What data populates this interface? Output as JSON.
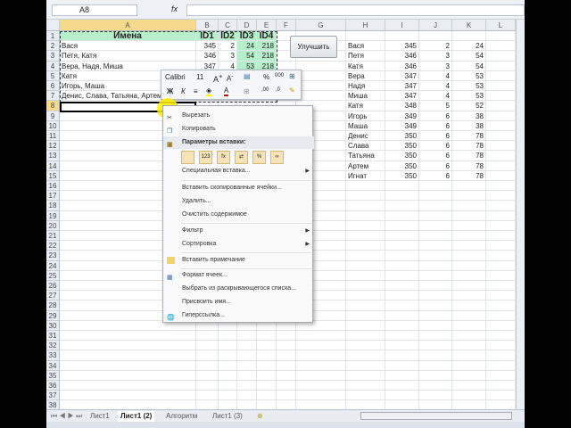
{
  "formula_bar": {
    "name_box": "A8",
    "fx": "fx",
    "formula": ""
  },
  "columns": [
    "A",
    "B",
    "C",
    "D",
    "E",
    "F",
    "G",
    "H",
    "I",
    "J",
    "K",
    "L"
  ],
  "header_row": [
    "Имена",
    "ID1",
    "ID2",
    "ID3",
    "ID4"
  ],
  "table": [
    [
      "Вася",
      "345",
      "2",
      "24",
      "218"
    ],
    [
      "Петя, Катя",
      "346",
      "3",
      "54",
      "218"
    ],
    [
      "Вера, Надя, Миша",
      "347",
      "4",
      "53",
      "218"
    ],
    [
      "Катя",
      "",
      "",
      "",
      ""
    ],
    [
      "Игорь, Маша",
      "",
      "",
      "",
      ""
    ],
    [
      "Денис, Слава, Татьяна, Артем, Игнат",
      "",
      "",
      "",
      ""
    ]
  ],
  "right_table": [
    [
      "Вася",
      "345",
      "2",
      "24"
    ],
    [
      "Петя",
      "346",
      "3",
      "54"
    ],
    [
      "Катя",
      "346",
      "3",
      "54"
    ],
    [
      "Вера",
      "347",
      "4",
      "53"
    ],
    [
      "Надя",
      "347",
      "4",
      "53"
    ],
    [
      "Миша",
      "347",
      "4",
      "53"
    ],
    [
      "Катя",
      "348",
      "5",
      "52"
    ],
    [
      "Игорь",
      "349",
      "6",
      "38"
    ],
    [
      "Маша",
      "349",
      "6",
      "38"
    ],
    [
      "Денис",
      "350",
      "6",
      "78"
    ],
    [
      "Слава",
      "350",
      "6",
      "78"
    ],
    [
      "Татьяна",
      "350",
      "6",
      "78"
    ],
    [
      "Артем",
      "350",
      "6",
      "78"
    ],
    [
      "Игнат",
      "350",
      "6",
      "78"
    ]
  ],
  "button_improve": "Улучшить",
  "mini_toolbar": {
    "font": "Calibri",
    "size": "11",
    "bold": "Ж",
    "italic": "К",
    "percent": "%",
    "thousands": "000"
  },
  "context_menu": {
    "cut": "Вырезать",
    "copy": "Копировать",
    "paste_options": "Параметры вставки:",
    "paste_icons": [
      "",
      "123",
      "fx",
      "⇄",
      "%",
      "∞"
    ],
    "paste_special": "Специальная вставка...",
    "insert_copied": "Вставить скопированные ячейки...",
    "delete": "Удалить...",
    "clear": "Очистить содержимое",
    "filter": "Фильтр",
    "sort": "Сортировка",
    "insert_comment": "Вставить примечание",
    "format_cells": "Формат ячеек...",
    "pick_list": "Выбрать из раскрывающегося списка...",
    "define_name": "Присвоить имя...",
    "hyperlink": "Гиперссылка..."
  },
  "sheet_tabs": [
    {
      "label": "Лист1",
      "active": false
    },
    {
      "label": "Лист1 (2)",
      "active": true
    },
    {
      "label": "Алгоритм",
      "active": false
    },
    {
      "label": "Лист1 (3)",
      "active": false
    }
  ],
  "colors": {
    "header_fill": "#b7efcb",
    "selection": "#f7d98c"
  }
}
